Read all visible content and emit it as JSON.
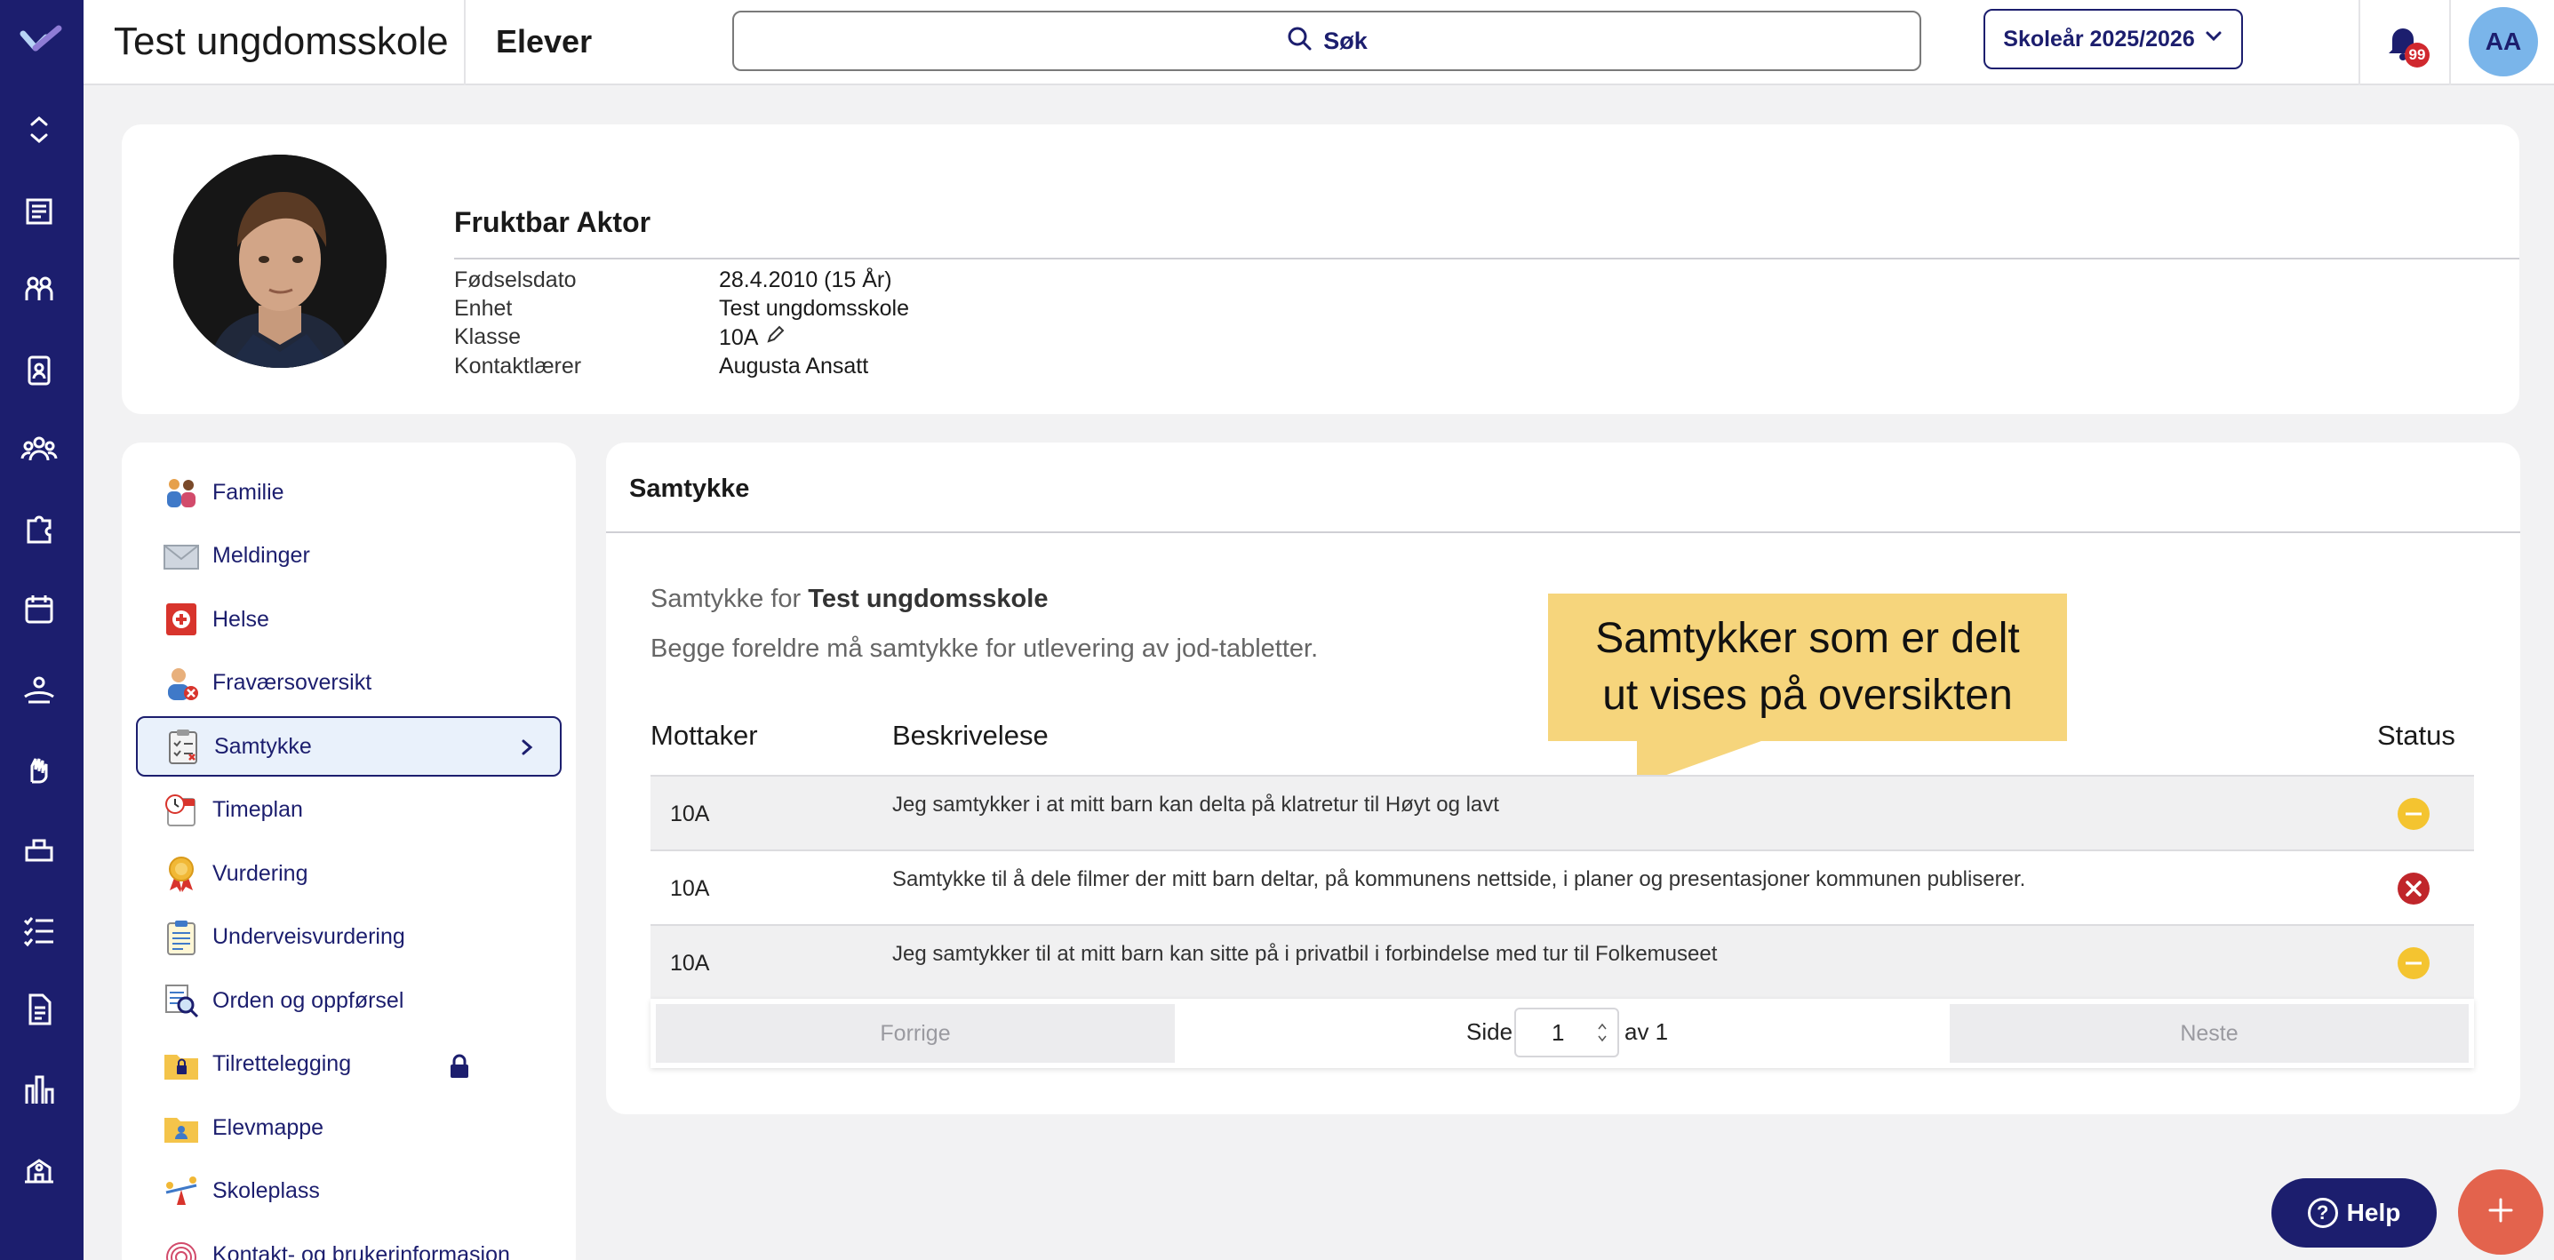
{
  "header": {
    "app_title": "Test ungdomsskole",
    "section": "Elever",
    "search_label": "Søk",
    "school_year": "Skoleår 2025/2026",
    "notification_count": "99",
    "user_initials": "AA"
  },
  "profile": {
    "name": "Fruktbar Aktor",
    "fields": [
      {
        "label": "Fødselsdato",
        "value": "28.4.2010 (15 År)"
      },
      {
        "label": "Enhet",
        "value": "Test ungdomsskole"
      },
      {
        "label": "Klasse",
        "value": "10A"
      },
      {
        "label": "Kontaktlærer",
        "value": "Augusta Ansatt"
      }
    ]
  },
  "menu": {
    "items": [
      {
        "label": "Familie",
        "icon": "family-icon"
      },
      {
        "label": "Meldinger",
        "icon": "envelope-icon"
      },
      {
        "label": "Helse",
        "icon": "first-aid-icon"
      },
      {
        "label": "Fraværsoversikt",
        "icon": "absence-icon"
      },
      {
        "label": "Samtykke",
        "icon": "clipboard-check-icon"
      },
      {
        "label": "Timeplan",
        "icon": "calendar-clock-icon"
      },
      {
        "label": "Vurdering",
        "icon": "medal-icon"
      },
      {
        "label": "Underveisvurdering",
        "icon": "clipboard-list-icon"
      },
      {
        "label": "Orden og oppførsel",
        "icon": "magnifier-doc-icon"
      },
      {
        "label": "Tilrettelegging",
        "icon": "folder-lock-icon"
      },
      {
        "label": "Elevmappe",
        "icon": "folder-user-icon"
      },
      {
        "label": "Skoleplass",
        "icon": "seesaw-icon"
      },
      {
        "label": "Kontakt- og brukerinformasjon",
        "icon": "fingerprint-icon"
      }
    ],
    "active": "Samtykke"
  },
  "consent": {
    "title": "Samtykke",
    "for_prefix": "Samtykke for",
    "for_school": "Test ungdomsskole",
    "description": "Begge foreldre må samtykke for utlevering av jod-tabletter.",
    "tooltip_line1": "Samtykker som er delt",
    "tooltip_line2": "ut vises på oversikten",
    "columns": [
      "Mottaker",
      "Beskrivelese",
      "Status"
    ],
    "rows": [
      {
        "recipient": "10A",
        "description": "Jeg samtykker i at mitt barn kan delta på klatretur til Høyt og lavt",
        "status": "pending"
      },
      {
        "recipient": "10A",
        "description": "Samtykke til å dele filmer der mitt barn deltar, på kommunens nettside, i planer og presentasjoner kommunen publiserer.",
        "status": "denied"
      },
      {
        "recipient": "10A",
        "description": "Jeg samtykker til at mitt barn kan sitte på i privatbil i forbindelse med tur til Folkemuseet",
        "status": "pending"
      }
    ],
    "pager": {
      "prev": "Forrige",
      "next": "Neste",
      "page_label": "Side",
      "page_value": "1",
      "of_label": "av 1"
    }
  },
  "floating": {
    "help": "Help"
  },
  "colors": {
    "navy": "#1c1e6e",
    "pending": "#f4c430",
    "denied": "#c0262b",
    "tooltip": "#f6d57c",
    "fab": "#e3634d"
  }
}
